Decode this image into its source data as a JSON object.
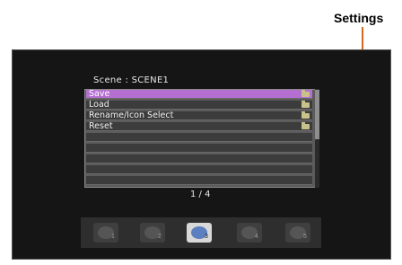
{
  "callout": {
    "label": "Settings"
  },
  "menu": {
    "title": "Scene : SCENE1",
    "items": [
      {
        "label": "Save",
        "icon": "folder-icon",
        "selected": true
      },
      {
        "label": "Load",
        "icon": "folder-icon",
        "selected": false
      },
      {
        "label": "Rename/Icon Select",
        "icon": "folder-icon",
        "selected": false
      },
      {
        "label": "Reset",
        "icon": "folder-icon",
        "selected": false
      }
    ],
    "empty_rows": 5,
    "page_indicator": "1 / 4"
  },
  "scene_icons": [
    {
      "name": "scene-icon-1",
      "active": false,
      "number": "1"
    },
    {
      "name": "scene-icon-2",
      "active": false,
      "number": "2"
    },
    {
      "name": "scene-icon-3",
      "active": true,
      "number": "3"
    },
    {
      "name": "scene-icon-4",
      "active": false,
      "number": "4"
    },
    {
      "name": "scene-icon-5",
      "active": false,
      "number": "5"
    }
  ],
  "colors": {
    "selection": "#b56fd1",
    "callout": "#d2691e",
    "screen": "#151515"
  }
}
